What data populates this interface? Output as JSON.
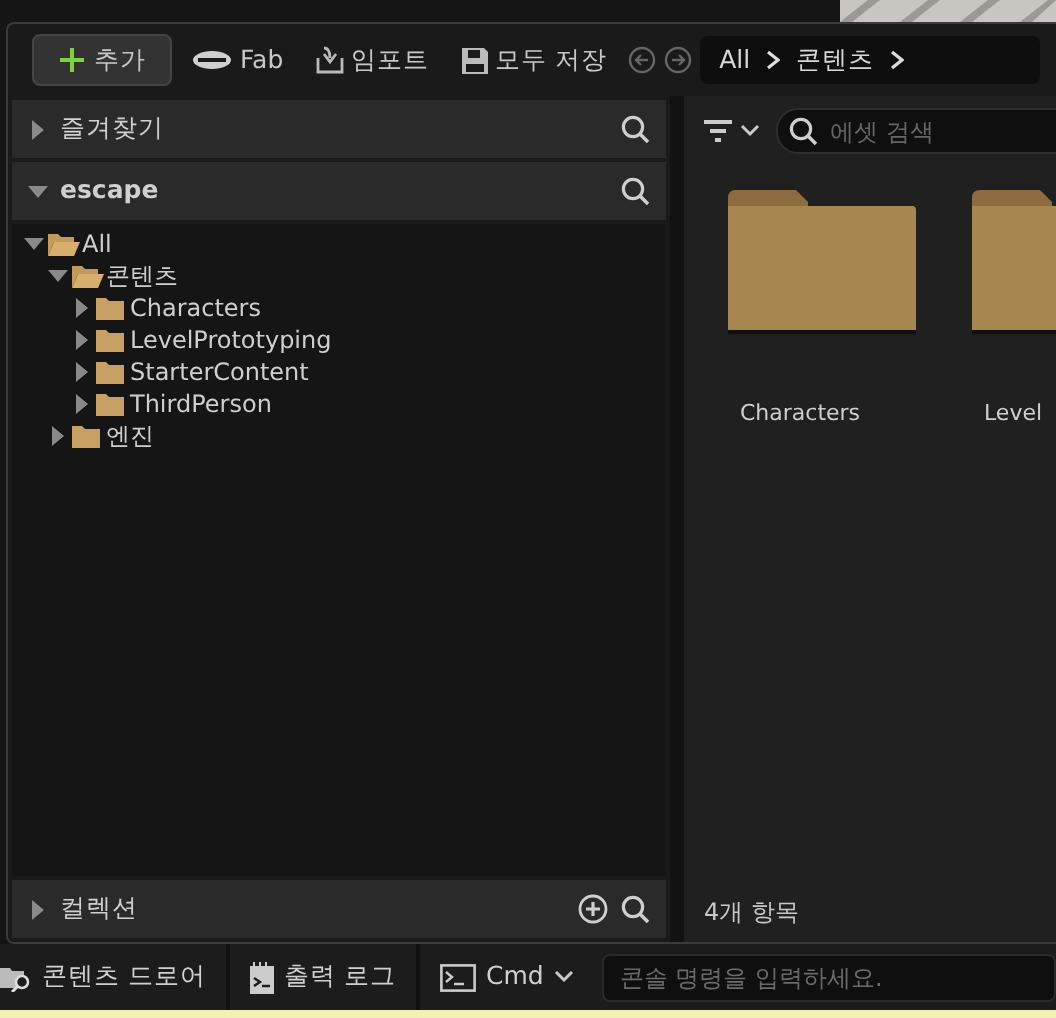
{
  "toolbar": {
    "add_button": "추가",
    "fab_button": "Fab",
    "import_button": "임포트",
    "save_all_button": "모두 저장",
    "breadcrumbs": [
      "All",
      "콘텐츠"
    ]
  },
  "favorites": {
    "title": "즐겨찾기",
    "expanded": false
  },
  "project": {
    "title": "escape",
    "expanded": true
  },
  "tree": [
    {
      "label": "All",
      "expanded": true,
      "children": [
        {
          "label": "콘텐츠",
          "expanded": true,
          "children": [
            {
              "label": "Characters",
              "expanded": false
            },
            {
              "label": "LevelPrototyping",
              "expanded": false
            },
            {
              "label": "StarterContent",
              "expanded": false
            },
            {
              "label": "ThirdPerson",
              "expanded": false
            }
          ]
        },
        {
          "label": "엔진",
          "expanded": false
        }
      ]
    }
  ],
  "collections": {
    "title": "컬렉션",
    "expanded": false
  },
  "asset_search": {
    "placeholder": "에셋 검색"
  },
  "assets": [
    {
      "label": "Characters"
    },
    {
      "label": "Level"
    }
  ],
  "item_count": "4개 항목",
  "status_bar": {
    "content_drawer": "콘텐츠 드로어",
    "output_log": "출력 로그",
    "cmd": "Cmd",
    "console": {
      "placeholder": "콘솔 명령을 입력하세요."
    }
  }
}
